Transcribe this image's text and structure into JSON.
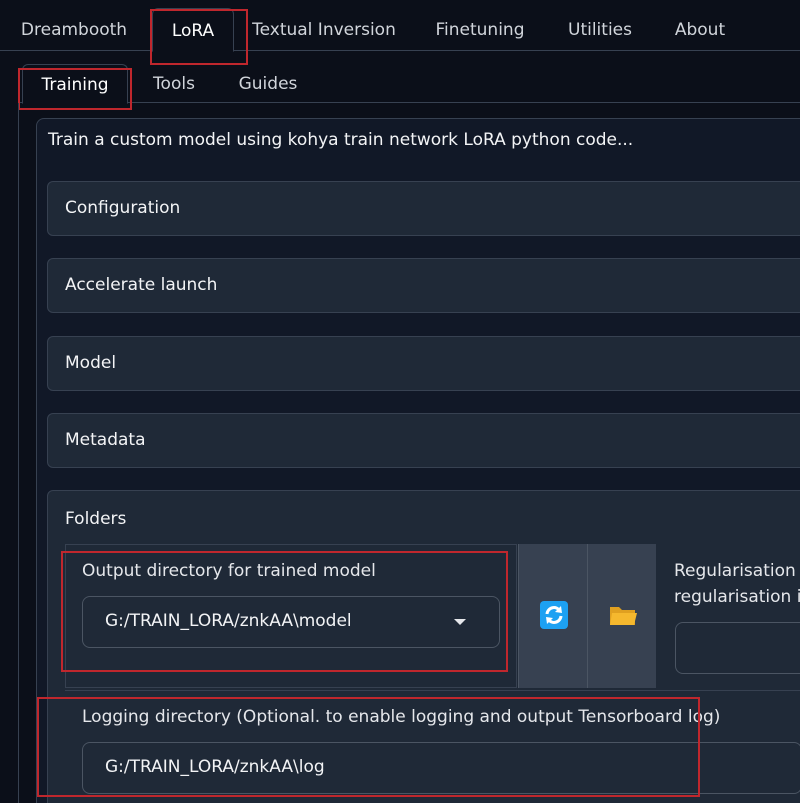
{
  "top_tabs": [
    "Dreambooth",
    "LoRA",
    "Textual Inversion",
    "Finetuning",
    "Utilities",
    "About"
  ],
  "active_top_tab": "LoRA",
  "sub_tabs": [
    "Training",
    "Tools",
    "Guides"
  ],
  "active_sub_tab": "Training",
  "description": "Train a custom model using kohya train network LoRA python code...",
  "accordions": [
    "Configuration",
    "Accelerate launch",
    "Model",
    "Metadata"
  ],
  "folders": {
    "title": "Folders",
    "output_dir_label": "Output directory for trained model",
    "output_dir_value": "G:/TRAIN_LORA/znkAA\\model",
    "reg_label_line1": "Regularisation d",
    "reg_label_line2": "regularisation ir",
    "logging_label": "Logging directory (Optional. to enable logging and output Tensorboard log)",
    "logging_value": "G:/TRAIN_LORA/znkAA\\log"
  },
  "icons": {
    "refresh": "refresh-icon",
    "folder": "folder-icon"
  },
  "colors": {
    "highlight": "#c0272d",
    "refresh_blue": "#1da1f2",
    "folder_yellow": "#f5b82e"
  }
}
